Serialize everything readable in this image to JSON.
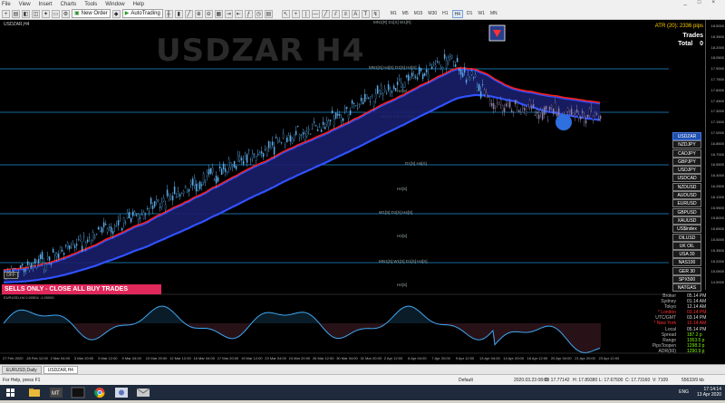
{
  "menu": {
    "items": [
      "File",
      "View",
      "Insert",
      "Charts",
      "Tools",
      "Window",
      "Help"
    ],
    "window_controls": [
      "_",
      "□",
      "×"
    ]
  },
  "toolbar": {
    "new_order": "New Order",
    "autotrading": "AutoTrading",
    "timeframes": [
      "M1",
      "M5",
      "M15",
      "M30",
      "H1",
      "H4",
      "D1",
      "W1",
      "MN"
    ],
    "active_timeframe": "H4"
  },
  "chart": {
    "symbol_title": "USDZAR H4",
    "info_line": "USDZAR,H4",
    "atr": "ATR (20): 2336 pips",
    "trades_label": "Trades",
    "total_label": "Total",
    "total_value": "0",
    "banner": "SELLS ONLY - CLOSE ALL BUY TRADES",
    "off_button": "OFF",
    "osc_title": "EURUSD,H4  0.00504  -1.00000",
    "level_labels": [
      "MN1[R] D1[S] W1[R]",
      "MN1[S] H4[S] D1[S] H4[S]",
      "H4[S]",
      "W1[S] D1[S] H4[S]",
      "D1[S] H4[S]",
      "H4[S]",
      "W1[S] D1[S] H4[S]",
      "H4[S]",
      "MN1[S] W1[S] D1[S] H4[S]",
      "H4[S]"
    ],
    "price_labels": [
      "18.5000",
      "18.3500",
      "18.2000",
      "18.0500",
      "17.9000",
      "17.7500",
      "17.6000",
      "17.4500",
      "17.3000",
      "17.1500",
      "17.0000",
      "16.8500",
      "16.7000",
      "16.5500",
      "16.4000",
      "16.2500",
      "16.1000",
      "15.9500",
      "15.8000",
      "15.6500",
      "15.5000",
      "15.3500",
      "15.2000",
      "15.0500",
      "14.9000"
    ],
    "time_labels": [
      "27 Feb 2020",
      "28 Feb 12:00",
      "2 Mar 04:00",
      "3 Mar 20:00",
      "5 Mar 12:00",
      "9 Mar 04:00",
      "10 Mar 20:00",
      "12 Mar 12:00",
      "16 Mar 04:00",
      "17 Mar 20:00",
      "19 Mar 12:00",
      "23 Mar 04:00",
      "24 Mar 20:00",
      "26 Mar 12:00",
      "30 Mar 04:00",
      "31 Mar 20:00",
      "2 Apr 12:00",
      "6 Apr 04:00",
      "7 Apr 20:00",
      "9 Apr 12:00",
      "13 Apr 04:00",
      "14 Apr 20:00",
      "16 Apr 12:00",
      "20 Apr 04:00",
      "21 Apr 20:00",
      "23 Apr 12:00"
    ]
  },
  "pairs": [
    "USDZAR",
    "NZDJPY",
    "CADJPY",
    "GBPJPY",
    "USDJPY",
    "USDCAD",
    "NZDUSD",
    "AUDUSD",
    "EURUSD",
    "GBPUSD",
    "XAUUSD",
    "US$index",
    "OILUSD",
    "UK OIL",
    "USA 30",
    "NAS100",
    "GER 30",
    "SPX500",
    "NATGAS"
  ],
  "selected_pair": "USDZAR",
  "stats": [
    {
      "k": "Broker",
      "v": "05.14 PM"
    },
    {
      "k": "Sydney",
      "v": "01.14 AM"
    },
    {
      "k": "Tokyo",
      "v": "12.14 AM"
    },
    {
      "k": "* London",
      "v": "03.14 PM"
    },
    {
      "k": "UTC/GMT",
      "v": "03.14 PM"
    },
    {
      "k": "* New York",
      "v": "10.14 AM"
    },
    {
      "k": "Local",
      "v": "05.14 PM"
    },
    {
      "k": "Spread",
      "v": "187.2 p"
    },
    {
      "k": "Range",
      "v": "1353.5 p"
    },
    {
      "k": "PipsToopen",
      "v": "1298.3 p"
    },
    {
      "k": "ADR(60)",
      "v": "1290.9 p"
    }
  ],
  "tabs": [
    "EURUSD,Daily",
    "USDZAR,H4"
  ],
  "active_tab": "USDZAR,H4",
  "status": {
    "help": "For Help, press F1",
    "profile": "Default",
    "datetime": "2020.03.23 08:00",
    "open": "O: 17.77142",
    "high": "H: 17.89380",
    "low": "L: 17.67500",
    "close": "C: 17.73160",
    "volume": "V: 7109",
    "traffic": "55633/9 kb"
  },
  "taskbar": {
    "time": "17:14:14",
    "date": "13 Apr 2020",
    "lang": "ENG"
  },
  "colors": {
    "ema_band_fill": "#1a1e6a",
    "ema_blue": "#2f52ff",
    "ema_red": "#ff2020",
    "level_line": "#1e8fd6",
    "candle": "#5aa9e6",
    "banner": "#e0285a"
  }
}
